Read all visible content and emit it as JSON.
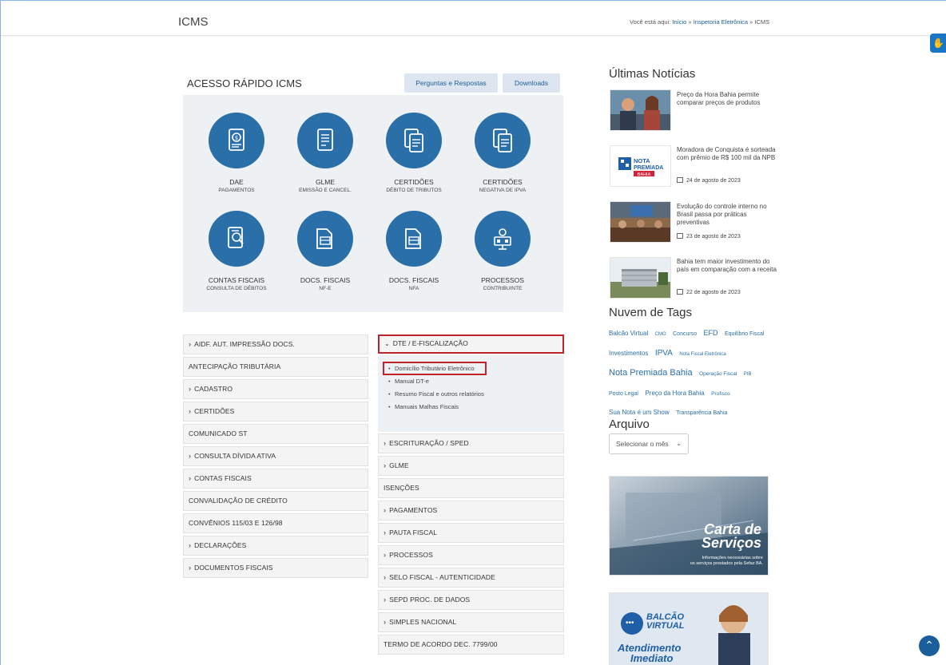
{
  "header": {
    "title": "ICMS",
    "breadcrumb_prefix": "Você está aqui:",
    "breadcrumb_home": "Início",
    "breadcrumb_sep1": "»",
    "breadcrumb_mid": "Inspetoria Eletrônica",
    "breadcrumb_sep2": "»",
    "breadcrumb_current": "ICMS"
  },
  "quick_access": {
    "title": "ACESSO RÁPIDO ICMS",
    "btn_faq": "Perguntas e Respostas",
    "btn_downloads": "Downloads",
    "tiles": [
      {
        "label": "DAE",
        "sub": "PAGAMENTOS",
        "icon": "receipt-coin-icon"
      },
      {
        "label": "GLME",
        "sub": "EMISSÃO E CANCEL.",
        "icon": "document-icon"
      },
      {
        "label": "CERTIDÕES",
        "sub": "DÉBITO DE TRIBUTOS",
        "icon": "documents-icon"
      },
      {
        "label": "CERTIDÕES",
        "sub": "NEGATIVA DE IPVA",
        "icon": "documents-icon"
      },
      {
        "label": "CONTAS FISCAIS",
        "sub": "CONSULTA DE DÉBITOS",
        "icon": "account-search-icon"
      },
      {
        "label": "DOCS. FISCAIS",
        "sub": "NF-E",
        "icon": "folder-doc-icon"
      },
      {
        "label": "DOCS. FISCAIS",
        "sub": "NFA",
        "icon": "folder-doc-icon"
      },
      {
        "label": "PROCESSOS",
        "sub": "CONTRIBUINTE",
        "icon": "process-icon"
      }
    ]
  },
  "left_menu": [
    {
      "label": "AIDF. AUT. IMPRESSÃO DOCS.",
      "chevron": true
    },
    {
      "label": "ANTECIPAÇÃO TRIBUTÁRIA",
      "chevron": false
    },
    {
      "label": "CADASTRO",
      "chevron": true
    },
    {
      "label": "CERTIDÕES",
      "chevron": true
    },
    {
      "label": "COMUNICADO ST",
      "chevron": false
    },
    {
      "label": "CONSULTA DÍVIDA ATIVA",
      "chevron": true
    },
    {
      "label": "CONTAS FISCAIS",
      "chevron": true
    },
    {
      "label": "CONVALIDAÇÃO DE CRÉDITO",
      "chevron": false
    },
    {
      "label": "CONVÊNIOS 115/03 E 126/98",
      "chevron": false
    },
    {
      "label": "DECLARAÇÕES",
      "chevron": true
    },
    {
      "label": "DOCUMENTOS FISCAIS",
      "chevron": true
    }
  ],
  "dte": {
    "header": "DTE / E-FISCALIZAÇÃO",
    "links": [
      "Domicílio Tributário Eletrônico",
      "Manual DT-e",
      "Resumo Fiscal e outros relatórios",
      "Manuais Malhas Fiscais"
    ]
  },
  "right_menu": [
    {
      "label": "ESCRITURAÇÃO / SPED",
      "chevron": true
    },
    {
      "label": "GLME",
      "chevron": true
    },
    {
      "label": "ISENÇÕES",
      "chevron": false
    },
    {
      "label": "PAGAMENTOS",
      "chevron": true
    },
    {
      "label": "PAUTA FISCAL",
      "chevron": true
    },
    {
      "label": "PROCESSOS",
      "chevron": true
    },
    {
      "label": "SELO FISCAL - AUTENTICIDADE",
      "chevron": true
    },
    {
      "label": "SEPD PROC. DE DADOS",
      "chevron": true
    },
    {
      "label": "SIMPLES NACIONAL",
      "chevron": true
    },
    {
      "label": "TERMO DE ACORDO DEC. 7799/00",
      "chevron": false
    }
  ],
  "news": {
    "title": "Últimas Notícias",
    "items": [
      {
        "text": "Preço da Hora Bahia permite comparar preços de produtos",
        "date": ""
      },
      {
        "text": "Moradora de Conquista é sorteada com prêmio de R$ 100 mil da NPB",
        "date": "24 de agosto de 2023"
      },
      {
        "text": "Evolução do controle interno no Brasil passa por práticas preventivas",
        "date": "23 de agosto de 2023"
      },
      {
        "text": "Bahia tem maior investimento do país em comparação com a receita",
        "date": "22 de agosto de 2023"
      }
    ],
    "npb_logo_line1": "NOTA",
    "npb_logo_line2": "PREMIADA",
    "npb_logo_line3": "BAHIA"
  },
  "tags": {
    "title": "Nuvem de Tags",
    "items": [
      {
        "label": "Balcão Virtual",
        "size": 8
      },
      {
        "label": "CMO",
        "size": 6
      },
      {
        "label": "Concurso",
        "size": 7
      },
      {
        "label": "EFD",
        "size": 9
      },
      {
        "label": "Equilíbrio Fiscal",
        "size": 7
      },
      {
        "label": "Investimentos",
        "size": 8
      },
      {
        "label": "IPVA",
        "size": 10
      },
      {
        "label": "Nota Fiscal Eletrônica",
        "size": 6
      },
      {
        "label": "Nota Premiada Bahia",
        "size": 11
      },
      {
        "label": "Operação Fiscal",
        "size": 6.5
      },
      {
        "label": "PIB",
        "size": 6
      },
      {
        "label": "Posto Legal",
        "size": 7
      },
      {
        "label": "Preço da Hora Bahia",
        "size": 8
      },
      {
        "label": "Profisco",
        "size": 6.5
      },
      {
        "label": "Sua Nota é um Show",
        "size": 8
      },
      {
        "label": "Transparência Bahia",
        "size": 7
      }
    ]
  },
  "archive": {
    "title": "Arquivo",
    "select_value": "Selecionar o mês"
  },
  "banners": {
    "carta_line1": "Carta de",
    "carta_line2": "Serviços",
    "carta_sub1": "Informações necessárias sobre",
    "carta_sub2": "os serviços prestados pela Sefaz BA.",
    "balcao_line1": "BALCÃO",
    "balcao_line2": "VIRTUAL",
    "balcao_line3": "Atendimento",
    "balcao_line4": "Imediato"
  },
  "colors": {
    "accent": "#2a6fa8",
    "highlight": "#c0232b",
    "link": "#1b5e9c"
  }
}
